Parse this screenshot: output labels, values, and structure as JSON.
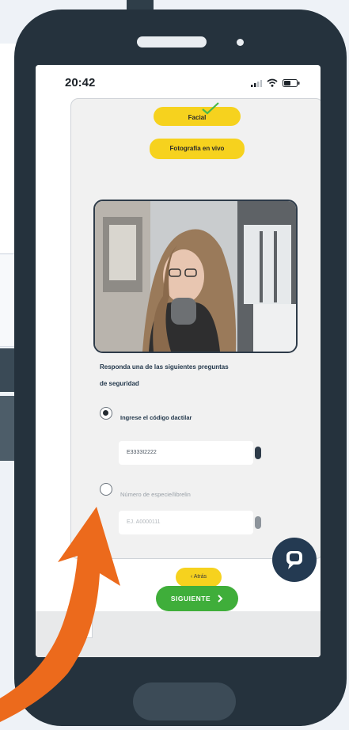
{
  "status_bar": {
    "time": "20:42"
  },
  "card": {
    "facial_label": "Facial",
    "live_photo_label": "Fotografía en vivo",
    "question_heading_line1": "Responda una de las siguientes preguntas",
    "question_heading_line2": "de seguridad",
    "option1": {
      "label": "Ingrese el código dactilar",
      "value": "E3333I2222",
      "selected": true
    },
    "option2": {
      "label": "Número de especie/librelin",
      "placeholder": "EJ. A0000111",
      "selected": false
    },
    "back_label": "‹ Atrás"
  },
  "next_button": {
    "label": "SIGUIENTE"
  },
  "colors": {
    "phone_body": "#25323d",
    "pill_yellow": "#f6d21e",
    "next_green": "#3fae3a",
    "arrow_orange": "#ec6a1c",
    "chat_navy": "#243a52"
  },
  "icons": {
    "facial_check": "checkmark-icon",
    "chat": "chat-bubble-icon",
    "next_chevron": "chevron-right-icon"
  }
}
